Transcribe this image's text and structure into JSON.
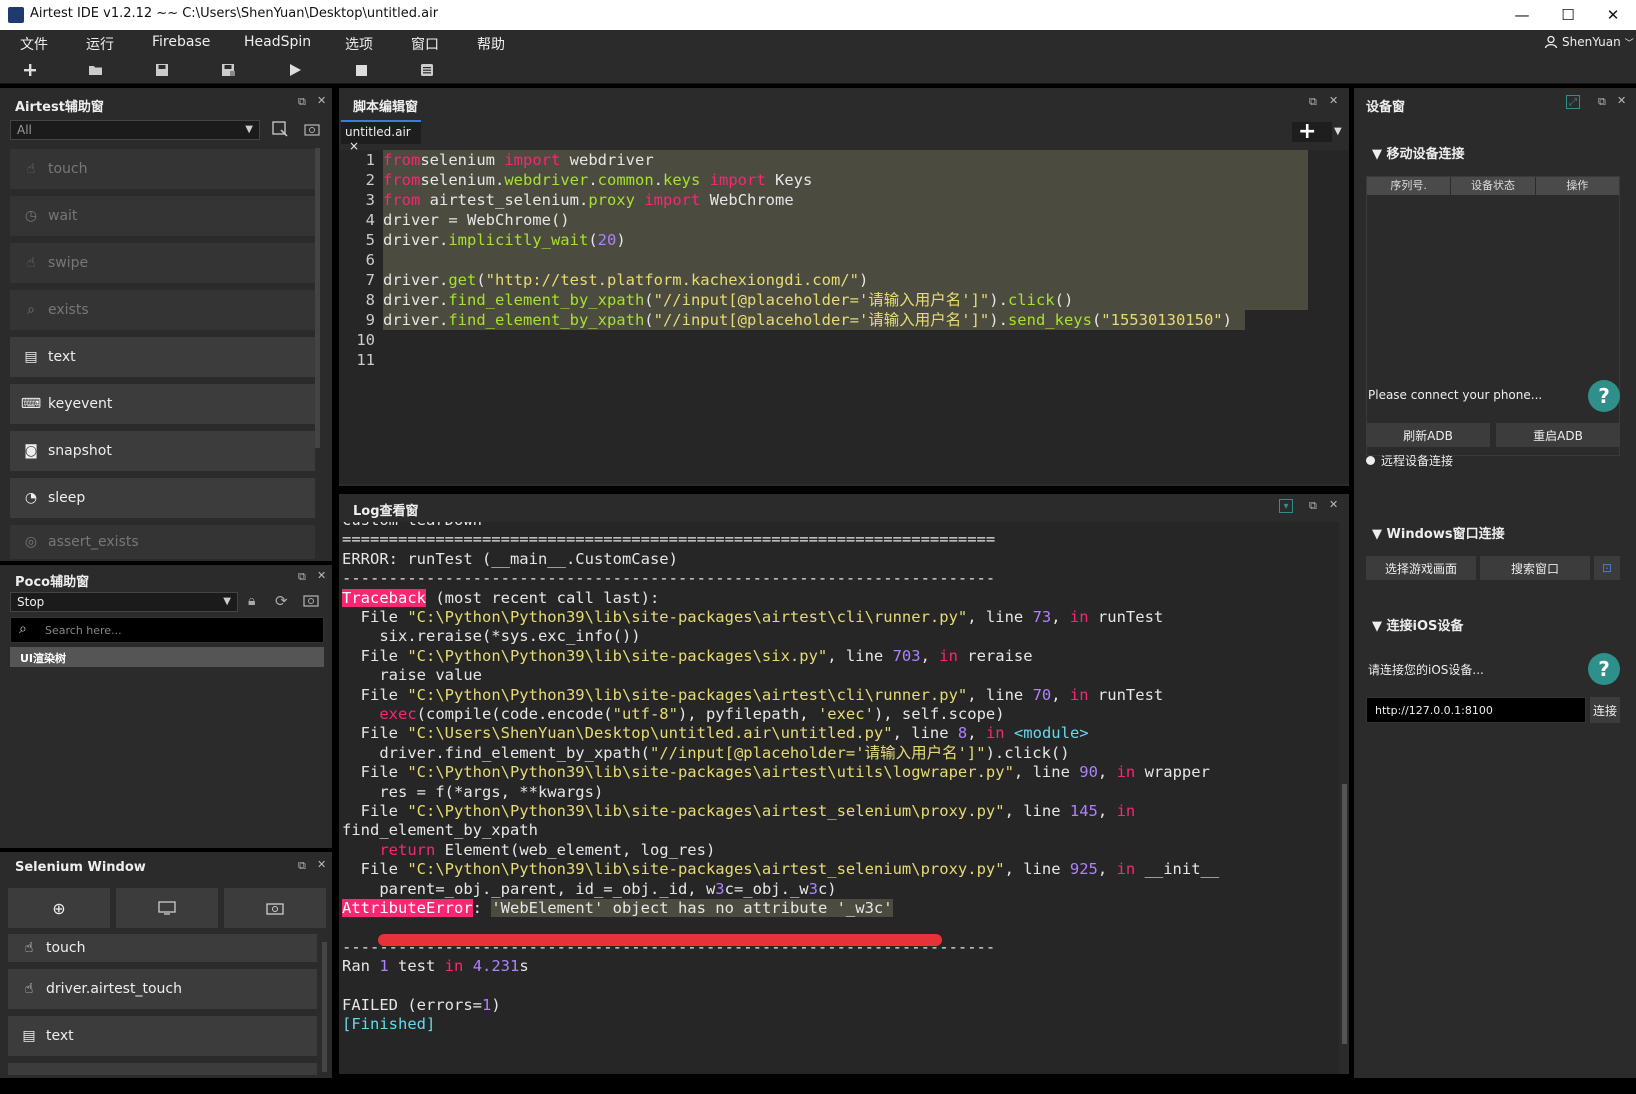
{
  "window": {
    "title": "Airtest IDE v1.2.12 ~~ C:\\Users\\ShenYuan\\Desktop\\untitled.air",
    "minimize": "—",
    "maximize": "☐",
    "close": "✕"
  },
  "menu": {
    "items": [
      "文件",
      "运行",
      "Firebase",
      "HeadSpin",
      "选项",
      "窗口",
      "帮助"
    ],
    "user": "ShenYuan"
  },
  "toolbar": {
    "icons": [
      "new-icon",
      "open-folder-icon",
      "save-icon",
      "save-as-icon",
      "run-icon",
      "stop-icon",
      "log-icon"
    ]
  },
  "airtest_panel": {
    "title": "Airtest辅助窗",
    "filter": "All",
    "items": [
      {
        "label": "touch",
        "icon": "hand-icon",
        "enabled": false
      },
      {
        "label": "wait",
        "icon": "clock-icon",
        "enabled": false
      },
      {
        "label": "swipe",
        "icon": "swipe-icon",
        "enabled": false
      },
      {
        "label": "exists",
        "icon": "magnifier-icon",
        "enabled": false
      },
      {
        "label": "text",
        "icon": "keyboard-icon",
        "enabled": true
      },
      {
        "label": "keyevent",
        "icon": "keys-icon",
        "enabled": true
      },
      {
        "label": "snapshot",
        "icon": "camera-icon",
        "enabled": true
      },
      {
        "label": "sleep",
        "icon": "moon-clock-icon",
        "enabled": true
      },
      {
        "label": "assert_exists",
        "icon": "assert-icon",
        "enabled": false
      }
    ]
  },
  "poco_panel": {
    "title": "Poco辅助窗",
    "mode": "Stop",
    "search_placeholder": "Search here...",
    "tree_root": "UI渲染树"
  },
  "selenium_panel": {
    "title": "Selenium Window",
    "items": [
      {
        "label": "touch",
        "icon": "hand-icon"
      },
      {
        "label": "driver.airtest_touch",
        "icon": "hand-icon"
      },
      {
        "label": "text",
        "icon": "keyboard-icon"
      }
    ]
  },
  "editor": {
    "title": "脚本编辑窗",
    "tab": "untitled.air",
    "tab_close": "×",
    "add": "+",
    "line_numbers": [
      "1",
      "2",
      "3",
      "4",
      "5",
      "6",
      "7",
      "8",
      "9",
      "10",
      "11"
    ],
    "lines": [
      [
        [
          "kw",
          "from"
        ],
        [
          "",
          "selenium "
        ],
        [
          "kw",
          "import"
        ],
        [
          "",
          " webdriver"
        ]
      ],
      [
        [
          "kw",
          "from"
        ],
        [
          "",
          "selenium."
        ],
        [
          "attr",
          "webdriver"
        ],
        [
          "",
          "."
        ],
        [
          "attr",
          "common"
        ],
        [
          "",
          "."
        ],
        [
          "attr",
          "keys"
        ],
        [
          "",
          " "
        ],
        [
          "kw",
          "import"
        ],
        [
          "",
          " Keys"
        ]
      ],
      [
        [
          "kw",
          "from"
        ],
        [
          "",
          " airtest_selenium."
        ],
        [
          "attr",
          "proxy"
        ],
        [
          "",
          " "
        ],
        [
          "kw",
          "import"
        ],
        [
          "",
          " WebChrome"
        ]
      ],
      [
        [
          "",
          "driver = WebChrome()"
        ]
      ],
      [
        [
          "",
          "driver."
        ],
        [
          "attr",
          "implicitly_wait"
        ],
        [
          "",
          "("
        ],
        [
          "num",
          "20"
        ],
        [
          "",
          ")"
        ]
      ],
      [],
      [
        [
          "",
          "driver."
        ],
        [
          "attr",
          "get"
        ],
        [
          "",
          "("
        ],
        [
          "str",
          "\"http://test.platform.kachexiongdi.com/\""
        ],
        [
          "",
          ")"
        ]
      ],
      [
        [
          "",
          "driver."
        ],
        [
          "attr",
          "find_element_by_xpath"
        ],
        [
          "",
          "("
        ],
        [
          "str",
          "\"//input[@placeholder='请输入用户名']\""
        ],
        [
          "",
          ")."
        ],
        [
          "attr",
          "click"
        ],
        [
          "",
          "()"
        ]
      ],
      [
        [
          "",
          "driver."
        ],
        [
          "attr",
          "find_element_by_xpath"
        ],
        [
          "",
          "("
        ],
        [
          "str",
          "\"//input[@placeholder='请输入用户名']\""
        ],
        [
          "",
          ")."
        ],
        [
          "attr",
          "send_keys"
        ],
        [
          "",
          "("
        ],
        [
          "str",
          "\"15530130150\""
        ],
        [
          "",
          ")"
        ]
      ],
      [],
      []
    ]
  },
  "log": {
    "title": "Log查看窗",
    "lines": [
      [
        [
          "",
          "custom tearDown"
        ]
      ],
      [
        [
          "",
          "======================================================================"
        ]
      ],
      [
        [
          "",
          "ERROR: runTest (__main__.CustomCase)"
        ]
      ],
      [
        [
          "",
          "----------------------------------------------------------------------"
        ]
      ],
      [
        [
          "pink",
          "Traceback"
        ],
        [
          "",
          " (most recent call last):"
        ]
      ],
      [
        [
          "",
          "  File "
        ],
        [
          "str",
          "\"C:\\Python\\Python39\\lib\\site-packages\\airtest\\cli\\runner.py\""
        ],
        [
          "",
          ", line "
        ],
        [
          "num",
          "73"
        ],
        [
          "",
          ", "
        ],
        [
          "kw",
          "in"
        ],
        [
          "",
          " runTest"
        ]
      ],
      [
        [
          "",
          "    six.reraise(*sys.exc_info())"
        ]
      ],
      [
        [
          "",
          "  File "
        ],
        [
          "str",
          "\"C:\\Python\\Python39\\lib\\site-packages\\six.py\""
        ],
        [
          "",
          ", line "
        ],
        [
          "num",
          "703"
        ],
        [
          "",
          ", "
        ],
        [
          "kw",
          "in"
        ],
        [
          "",
          " reraise"
        ]
      ],
      [
        [
          "",
          "    raise value"
        ]
      ],
      [
        [
          "",
          "  File "
        ],
        [
          "str",
          "\"C:\\Python\\Python39\\lib\\site-packages\\airtest\\cli\\runner.py\""
        ],
        [
          "",
          ", line "
        ],
        [
          "num",
          "70"
        ],
        [
          "",
          ", "
        ],
        [
          "kw",
          "in"
        ],
        [
          "",
          " runTest"
        ]
      ],
      [
        [
          "",
          "    "
        ],
        [
          "kw",
          "exec"
        ],
        [
          "",
          "(compile(code.encode("
        ],
        [
          "str",
          "\"utf-8\""
        ],
        [
          "",
          "), pyfilepath, "
        ],
        [
          "str",
          "'exec'"
        ],
        [
          "",
          "), self.scope)"
        ]
      ],
      [
        [
          "",
          "  File "
        ],
        [
          "str",
          "\"C:\\Users\\ShenYuan\\Desktop\\untitled.air\\untitled.py\""
        ],
        [
          "",
          ", line "
        ],
        [
          "num",
          "8"
        ],
        [
          "",
          ", "
        ],
        [
          "kw",
          "in"
        ],
        [
          "",
          " "
        ],
        [
          "blt",
          "<module>"
        ]
      ],
      [
        [
          "",
          "    driver.find_element_by_xpath("
        ],
        [
          "str",
          "\"//input[@placeholder='请输入用户名']\""
        ],
        [
          "",
          ").click()"
        ]
      ],
      [
        [
          "",
          "  File "
        ],
        [
          "str",
          "\"C:\\Python\\Python39\\lib\\site-packages\\airtest\\utils\\logwraper.py\""
        ],
        [
          "",
          ", line "
        ],
        [
          "num",
          "90"
        ],
        [
          "",
          ", "
        ],
        [
          "kw",
          "in"
        ],
        [
          "",
          " wrapper"
        ]
      ],
      [
        [
          "",
          "    res = f(*args, **kwargs)"
        ]
      ],
      [
        [
          "",
          "  File "
        ],
        [
          "str",
          "\"C:\\Python\\Python39\\lib\\site-packages\\airtest_selenium\\proxy.py\""
        ],
        [
          "",
          ", line "
        ],
        [
          "num",
          "145"
        ],
        [
          "",
          ", "
        ],
        [
          "kw",
          "in"
        ]
      ],
      [
        [
          "",
          "find_element_by_xpath"
        ]
      ],
      [
        [
          "",
          "    "
        ],
        [
          "kw",
          "return"
        ],
        [
          "",
          " Element(web_element, log_res)"
        ]
      ],
      [
        [
          "",
          "  File "
        ],
        [
          "str",
          "\"C:\\Python\\Python39\\lib\\site-packages\\airtest_selenium\\proxy.py\""
        ],
        [
          "",
          ", line "
        ],
        [
          "num",
          "925"
        ],
        [
          "",
          ", "
        ],
        [
          "kw",
          "in"
        ],
        [
          "",
          " __init__"
        ]
      ],
      [
        [
          "",
          "    parent=_obj._parent, id_=_obj._id, w"
        ],
        [
          "num",
          "3"
        ],
        [
          "",
          "c=_obj._w"
        ],
        [
          "num",
          "3"
        ],
        [
          "",
          "c)"
        ]
      ],
      [
        [
          "pink",
          "AttributeError"
        ],
        [
          "",
          ": "
        ],
        [
          "gray",
          "'WebElement' object has no attribute '_w3c'"
        ]
      ],
      [],
      [
        [
          "",
          "----------------------------------------------------------------------"
        ]
      ],
      [
        [
          "",
          "Ran "
        ],
        [
          "num",
          "1"
        ],
        [
          "",
          " test "
        ],
        [
          "kw",
          "in"
        ],
        [
          "",
          " "
        ],
        [
          "num",
          "4.231"
        ],
        [
          "",
          "s"
        ]
      ],
      [],
      [
        [
          "",
          "FAILED (errors="
        ],
        [
          "num",
          "1"
        ],
        [
          "",
          ")"
        ]
      ],
      [
        [
          "blt",
          "[Finished]"
        ]
      ]
    ]
  },
  "device_panel": {
    "title": "设备窗",
    "mobile_section": "移动设备连接",
    "table_headers": [
      "序列号.",
      "设备状态",
      "操作"
    ],
    "connect_hint": "Please connect your phone...",
    "refresh_adb": "刷新ADB",
    "restart_adb": "重启ADB",
    "remote_connect": "远程设备连接",
    "windows_section": "Windows窗口连接",
    "select_game": "选择游戏画面",
    "search_window": "搜索窗口",
    "ios_section": "连接iOS设备",
    "ios_hint": "请连接您的iOS设备...",
    "ios_url": "http://127.0.0.1:8100",
    "ios_connect": "连接",
    "help": "?"
  },
  "colors": {
    "annotation_red": "#e8323a",
    "keyword": "#f92672",
    "attribute": "#a6e22e",
    "string": "#e6db74",
    "number": "#ae81ff",
    "builtin": "#66d9ef",
    "help_teal": "#2f8f8a"
  }
}
